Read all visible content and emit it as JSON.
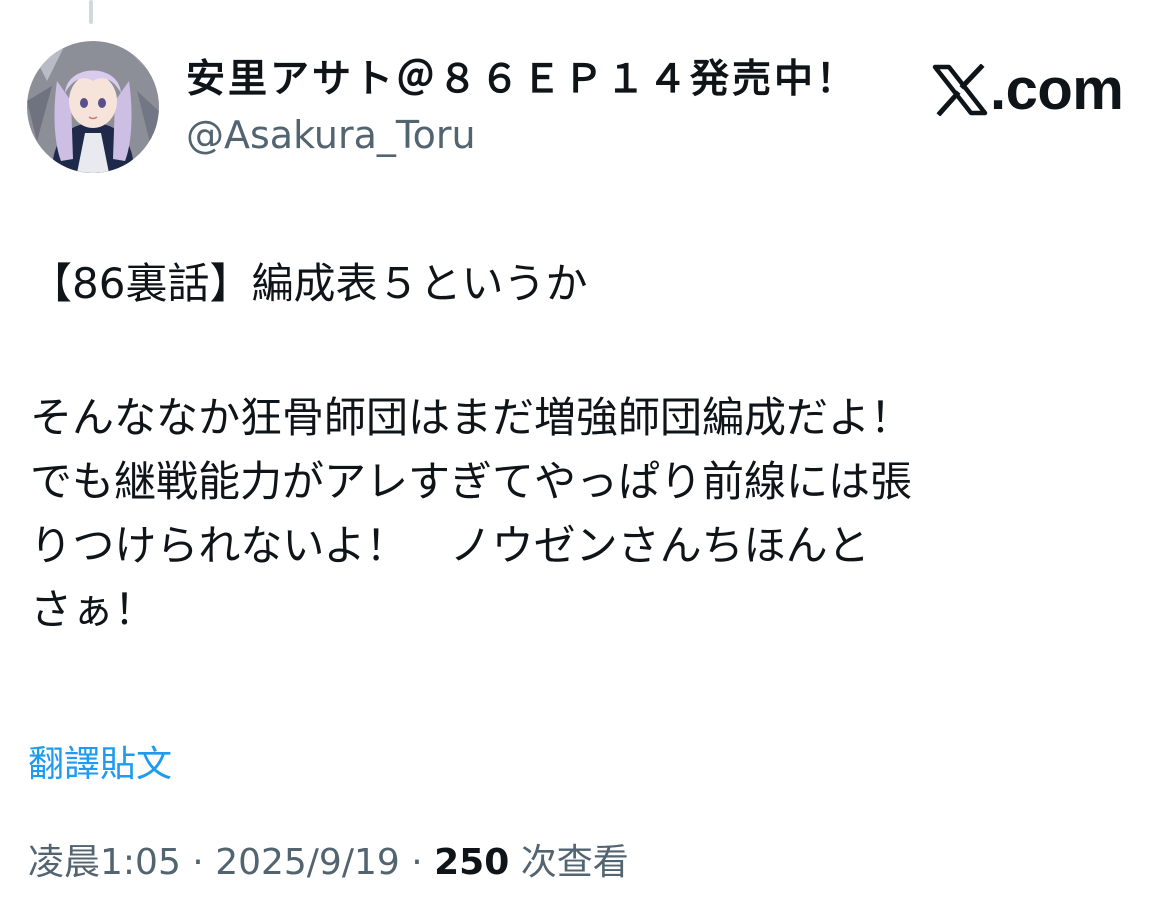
{
  "author": {
    "display_name": "安里アサト＠８６ＥＰ１４発売中！",
    "handle": "@Asakura_Toru",
    "avatar_icon": "anime-girl-avatar"
  },
  "brand": {
    "logo_icon": "x-logo-icon",
    "site_label": ".com"
  },
  "tweet": {
    "lines": [
      "【86裏話】編成表５というか",
      "そんななか狂骨師団はまだ増強師団編成だよ！",
      "でも継戦能力がアレすぎてやっぱり前線には張",
      "りつけられないよ！　ノウゼンさんちほんと",
      "さぁ！"
    ]
  },
  "translate_label": "翻譯貼文",
  "meta": {
    "time": "凌晨1:05",
    "separator": " · ",
    "date": "2025/9/19",
    "views_count": "250",
    "views_label": " 次查看"
  },
  "colors": {
    "text": "#0f1419",
    "secondary": "#536471",
    "link": "#1d9bf0"
  }
}
